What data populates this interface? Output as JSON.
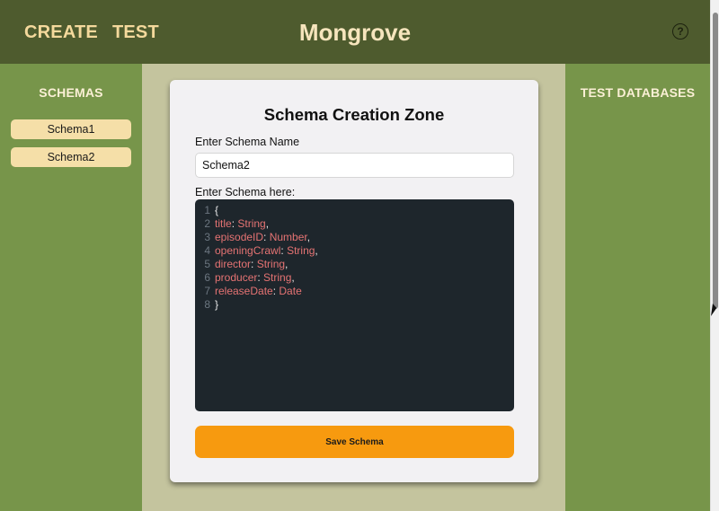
{
  "header": {
    "nav": [
      "CREATE",
      "TEST"
    ],
    "title": "Mongrove",
    "help_icon": "?"
  },
  "sidebar_left": {
    "heading": "SCHEMAS",
    "items": [
      "Schema1",
      "Schema2"
    ]
  },
  "sidebar_right": {
    "heading": "TEST DATABASES"
  },
  "card": {
    "title": "Schema Creation Zone",
    "name_label": "Enter Schema Name",
    "name_value": "Schema2",
    "schema_label": "Enter Schema here:",
    "save_label": "Save Schema"
  },
  "editor": {
    "lines": [
      {
        "num": "1",
        "key": "",
        "sep": "",
        "type": "",
        "punct": "{"
      },
      {
        "num": "2",
        "key": "title",
        "sep": ": ",
        "type": "String",
        "punct": ","
      },
      {
        "num": "3",
        "key": "episodeID",
        "sep": ": ",
        "type": "Number",
        "punct": ","
      },
      {
        "num": "4",
        "key": "openingCrawl",
        "sep": ": ",
        "type": "String",
        "punct": ","
      },
      {
        "num": "5",
        "key": "director",
        "sep": ": ",
        "type": "String",
        "punct": ","
      },
      {
        "num": "6",
        "key": "producer",
        "sep": ": ",
        "type": "String",
        "punct": ","
      },
      {
        "num": "7",
        "key": "releaseDate",
        "sep": ": ",
        "type": "Date",
        "punct": ""
      },
      {
        "num": "8",
        "key": "",
        "sep": "",
        "type": "",
        "punct": "}"
      }
    ]
  },
  "colors": {
    "header_bg": "#4e5b2e",
    "sidebar_bg": "#77954a",
    "middle_bg": "#c4c49e",
    "nav_text": "#f4d99c",
    "schema_item_bg": "#f5dfa8",
    "save_button_bg": "#f79a0f",
    "editor_bg": "#1e262c",
    "code_token": "#e57373"
  }
}
